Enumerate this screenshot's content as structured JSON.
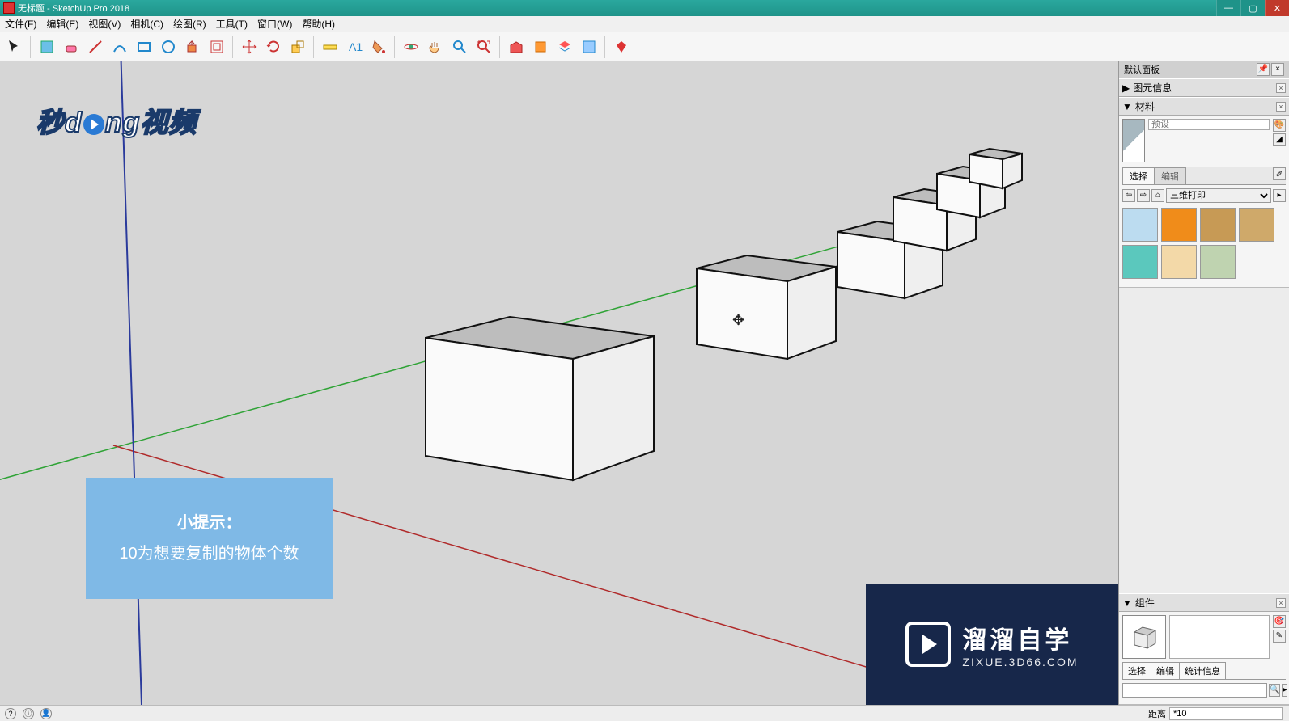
{
  "title": "无标题 - SketchUp Pro 2018",
  "menu": [
    "文件(F)",
    "编辑(E)",
    "视图(V)",
    "相机(C)",
    "绘图(R)",
    "工具(T)",
    "窗口(W)",
    "帮助(H)"
  ],
  "tray": {
    "title": "默认面板"
  },
  "panels": {
    "entity_info": {
      "title": "图元信息"
    },
    "materials": {
      "title": "材料",
      "name_placeholder": "预设",
      "tabs": [
        "选择",
        "编辑"
      ],
      "collection": "三维打印",
      "swatches": [
        "#bcdcf0",
        "#f08c1a",
        "#c79a55",
        "#cfa96a",
        "#5bc8bd",
        "#f3d9a8",
        "#bfd3b0"
      ]
    },
    "components": {
      "title": "组件",
      "tabs": [
        "选择",
        "编辑",
        "统计信息"
      ]
    }
  },
  "tip": {
    "heading": "小提示：",
    "body": "10为想要复制的物体个数"
  },
  "status": {
    "distance_label": "距离",
    "distance_value": "*10"
  },
  "watermark1_text_a": "秒",
  "watermark1_text_b": "ng视频",
  "watermark2": {
    "big": "溜溜自学",
    "small": "ZIXUE.3D66.COM"
  },
  "toolbar_icons": [
    "select",
    "sandbox",
    "eraser",
    "line",
    "protractor",
    "arc",
    "shapes",
    "pushpull",
    "offset",
    "move",
    "rotate",
    "scale",
    "tape",
    "text",
    "dimension",
    "paint",
    "orbit",
    "pan",
    "zoom",
    "zoom-extents",
    "prev-view",
    "next-view",
    "iso-view",
    "section",
    "layers",
    "outliner",
    "ruby"
  ]
}
